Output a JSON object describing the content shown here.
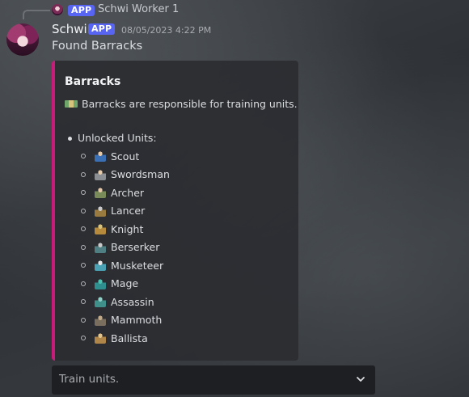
{
  "reply": {
    "badge": "APP",
    "name": "Schwi Worker 1"
  },
  "message": {
    "author": "Schwi",
    "badge": "APP",
    "timestamp": "08/05/2023 4:22 PM",
    "content": "Found Barracks"
  },
  "embed": {
    "accent_color": "#c81b7a",
    "title": "Barracks",
    "description": "Barracks are responsible for training units.",
    "list_label": "Unlocked Units:",
    "units": [
      {
        "label": "Scout",
        "icon": "scout-icon"
      },
      {
        "label": "Swordsman",
        "icon": "swordsman-icon"
      },
      {
        "label": "Archer",
        "icon": "archer-icon"
      },
      {
        "label": "Lancer",
        "icon": "lancer-icon"
      },
      {
        "label": "Knight",
        "icon": "knight-icon"
      },
      {
        "label": "Berserker",
        "icon": "berserker-icon"
      },
      {
        "label": "Musketeer",
        "icon": "musketeer-icon"
      },
      {
        "label": "Mage",
        "icon": "mage-icon"
      },
      {
        "label": "Assassin",
        "icon": "assassin-icon"
      },
      {
        "label": "Mammoth",
        "icon": "mammoth-icon"
      },
      {
        "label": "Ballista",
        "icon": "ballista-icon"
      }
    ]
  },
  "select_menu": {
    "placeholder": "Train units."
  },
  "colors": {
    "app_badge": "#5865f2",
    "embed_bg": "#2b2d31",
    "select_bg": "#1e1f22"
  }
}
